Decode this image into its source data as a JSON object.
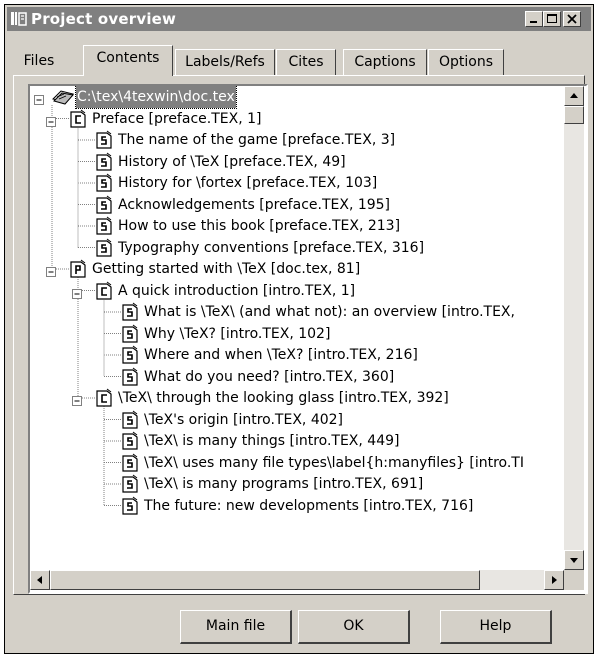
{
  "window": {
    "title": "Project overview",
    "icon": "texwin-app-icon"
  },
  "title_buttons": [
    "minimize-icon",
    "maximize-icon",
    "close-icon"
  ],
  "tabs": [
    {
      "label": "Files"
    },
    {
      "label": "Contents",
      "active": true
    },
    {
      "label": "Labels/Refs"
    },
    {
      "label": "Cites"
    },
    {
      "label": "Captions"
    },
    {
      "label": "Options"
    }
  ],
  "tree": {
    "root": {
      "label": "C:\\tex\\4texwin\\doc.tex",
      "icon": "tex-file-icon",
      "selected": true
    },
    "items": [
      {
        "level": 1,
        "icon": "C",
        "label": "Preface [preface.TEX, 1]",
        "expander": "minus"
      },
      {
        "level": 2,
        "icon": "S",
        "label": "The name of the game [preface.TEX, 3]"
      },
      {
        "level": 2,
        "icon": "S",
        "label": "History of \\TeX [preface.TEX, 49]"
      },
      {
        "level": 2,
        "icon": "S",
        "label": "History for \\fortex [preface.TEX, 103]"
      },
      {
        "level": 2,
        "icon": "S",
        "label": "Acknowledgements [preface.TEX, 195]"
      },
      {
        "level": 2,
        "icon": "S",
        "label": "How to use this book [preface.TEX, 213]"
      },
      {
        "level": 2,
        "icon": "S",
        "label": "Typography conventions [preface.TEX, 316]"
      },
      {
        "level": 1,
        "icon": "P",
        "label": "Getting started with \\TeX [doc.tex, 81]",
        "expander": "minus"
      },
      {
        "level": 2,
        "icon": "C",
        "label": "A quick introduction [intro.TEX, 1]",
        "expander": "minus"
      },
      {
        "level": 3,
        "icon": "S",
        "label": "What is \\TeX\\ (and what not): an overview [intro.TEX,"
      },
      {
        "level": 3,
        "icon": "S",
        "label": "Why \\TeX? [intro.TEX, 102]"
      },
      {
        "level": 3,
        "icon": "S",
        "label": "Where and when \\TeX? [intro.TEX, 216]"
      },
      {
        "level": 3,
        "icon": "S",
        "label": "What do you need? [intro.TEX, 360]"
      },
      {
        "level": 2,
        "icon": "C",
        "label": "\\TeX\\ through the looking glass [intro.TEX, 392]",
        "expander": "minus"
      },
      {
        "level": 3,
        "icon": "S",
        "label": "\\TeX's origin [intro.TEX, 402]"
      },
      {
        "level": 3,
        "icon": "S",
        "label": "\\TeX\\ is many things [intro.TEX, 449]"
      },
      {
        "level": 3,
        "icon": "S",
        "label": "\\TeX\\ uses many file types\\label{h:manyfiles} [intro.TI"
      },
      {
        "level": 3,
        "icon": "S",
        "label": "\\TeX\\ is many programs [intro.TEX, 691]"
      },
      {
        "level": 3,
        "icon": "S",
        "label": "The future: new developments [intro.TEX, 716]"
      }
    ]
  },
  "buttons": {
    "main_file": "Main file",
    "ok": "OK",
    "help": "Help"
  },
  "colors": {
    "title_bar": "#808080",
    "face": "#d4d0c8",
    "selection": "#808080"
  }
}
